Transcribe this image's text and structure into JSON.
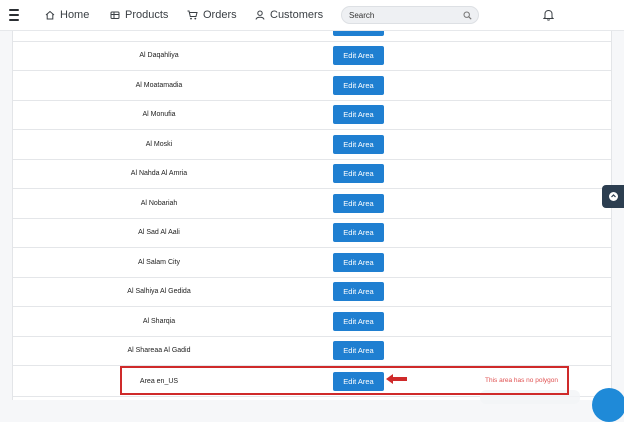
{
  "nav": {
    "home": "Home",
    "products": "Products",
    "orders": "Orders",
    "customers": "Customers",
    "search_placeholder": "Search"
  },
  "table": {
    "button_label": "Edit Area",
    "rows": [
      {
        "name": ""
      },
      {
        "name": "Al Daqahliya"
      },
      {
        "name": "Al Moatamadia"
      },
      {
        "name": "Al Monufia"
      },
      {
        "name": "Al Moski"
      },
      {
        "name": "Al Nahda Al Amria"
      },
      {
        "name": "Al Nobariah"
      },
      {
        "name": "Al Sad Al Aali"
      },
      {
        "name": "Al Salam City"
      },
      {
        "name": "Al Salhiya Al Gedida"
      },
      {
        "name": "Al Sharqia"
      },
      {
        "name": "Al Shareaa Al Gadid"
      },
      {
        "name": "Area en_US"
      }
    ]
  },
  "annotation": {
    "note": "This area has no polygon",
    "color": "#cf2a2a"
  },
  "colors": {
    "primary_button": "#1f7fd1"
  }
}
